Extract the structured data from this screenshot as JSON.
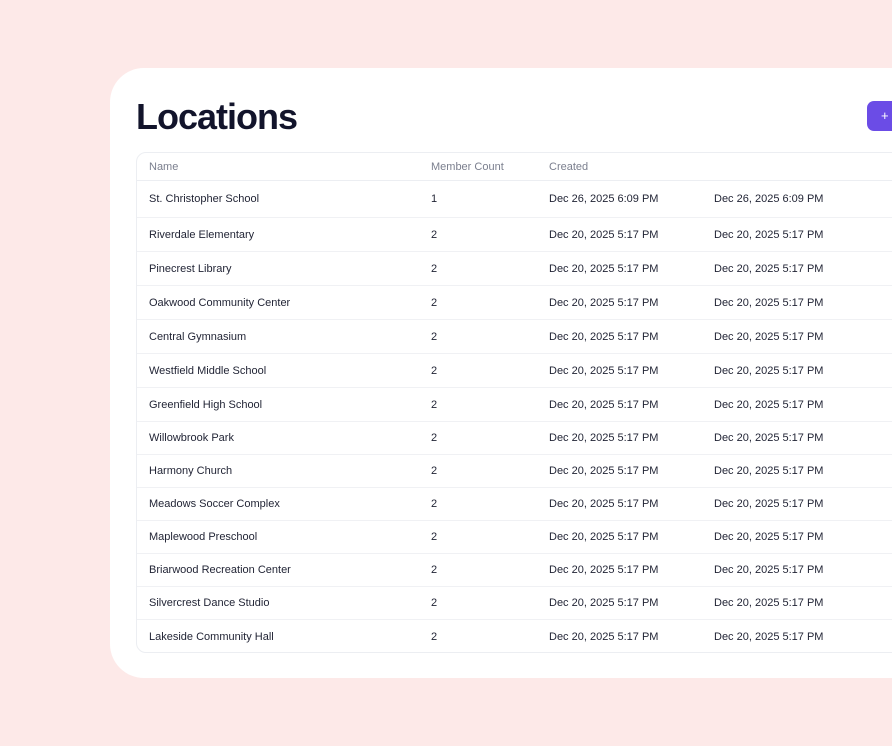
{
  "page": {
    "title": "Locations",
    "add_label": "+"
  },
  "table": {
    "columns": {
      "name": "Name",
      "member_count": "Member Count",
      "created": "Created",
      "updated": ""
    },
    "rows": [
      {
        "name": "St. Christopher School",
        "member_count": "1",
        "created": "Dec 26, 2025 6:09 PM",
        "updated": "Dec 26, 2025 6:09 PM"
      },
      {
        "name": "Riverdale Elementary",
        "member_count": "2",
        "created": "Dec 20, 2025 5:17 PM",
        "updated": "Dec 20, 2025 5:17 PM"
      },
      {
        "name": "Pinecrest Library",
        "member_count": "2",
        "created": "Dec 20, 2025 5:17 PM",
        "updated": "Dec 20, 2025 5:17 PM"
      },
      {
        "name": "Oakwood Community Center",
        "member_count": "2",
        "created": "Dec 20, 2025 5:17 PM",
        "updated": "Dec 20, 2025 5:17 PM"
      },
      {
        "name": "Central Gymnasium",
        "member_count": "2",
        "created": "Dec 20, 2025 5:17 PM",
        "updated": "Dec 20, 2025 5:17 PM"
      },
      {
        "name": "Westfield Middle School",
        "member_count": "2",
        "created": "Dec 20, 2025 5:17 PM",
        "updated": "Dec 20, 2025 5:17 PM"
      },
      {
        "name": "Greenfield High School",
        "member_count": "2",
        "created": "Dec 20, 2025 5:17 PM",
        "updated": "Dec 20, 2025 5:17 PM"
      },
      {
        "name": "Willowbrook Park",
        "member_count": "2",
        "created": "Dec 20, 2025 5:17 PM",
        "updated": "Dec 20, 2025 5:17 PM"
      },
      {
        "name": "Harmony Church",
        "member_count": "2",
        "created": "Dec 20, 2025 5:17 PM",
        "updated": "Dec 20, 2025 5:17 PM"
      },
      {
        "name": "Meadows Soccer Complex",
        "member_count": "2",
        "created": "Dec 20, 2025 5:17 PM",
        "updated": "Dec 20, 2025 5:17 PM"
      },
      {
        "name": "Maplewood Preschool",
        "member_count": "2",
        "created": "Dec 20, 2025 5:17 PM",
        "updated": "Dec 20, 2025 5:17 PM"
      },
      {
        "name": "Briarwood Recreation Center",
        "member_count": "2",
        "created": "Dec 20, 2025 5:17 PM",
        "updated": "Dec 20, 2025 5:17 PM"
      },
      {
        "name": "Silvercrest Dance Studio",
        "member_count": "2",
        "created": "Dec 20, 2025 5:17 PM",
        "updated": "Dec 20, 2025 5:17 PM"
      },
      {
        "name": "Lakeside Community Hall",
        "member_count": "2",
        "created": "Dec 20, 2025 5:17 PM",
        "updated": "Dec 20, 2025 5:17 PM"
      }
    ]
  },
  "colors": {
    "background": "#fde9e8",
    "card": "#ffffff",
    "accent": "#6b4ce6",
    "title": "#12142b"
  }
}
